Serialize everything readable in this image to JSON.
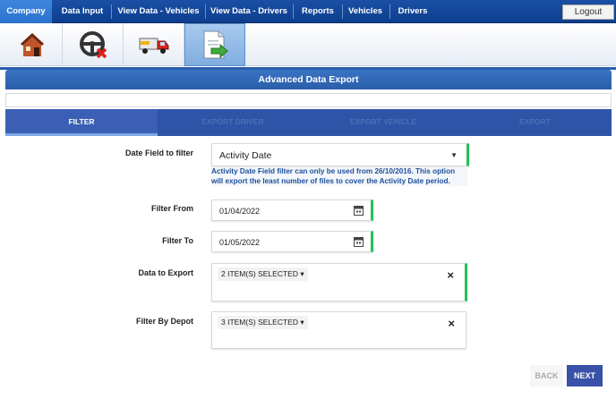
{
  "nav": {
    "items": [
      {
        "label": "Company",
        "active": true
      },
      {
        "label": "Data Input"
      },
      {
        "label": "View Data - Vehicles"
      },
      {
        "label": "View Data - Drivers"
      },
      {
        "label": "Reports"
      },
      {
        "label": "Vehicles"
      },
      {
        "label": "Drivers"
      }
    ],
    "logout": "Logout"
  },
  "toolbar": {
    "icons": [
      "house-icon",
      "steering-wheel-icon",
      "truck-icon",
      "export-document-icon"
    ],
    "active": "export-document-icon"
  },
  "page": {
    "title": "Advanced Data Export"
  },
  "steps": [
    {
      "label": "FILTER",
      "active": true
    },
    {
      "label": "EXPORT DRIVER"
    },
    {
      "label": "EXPORT VEHICLE"
    },
    {
      "label": "EXPORT"
    }
  ],
  "form": {
    "date_field": {
      "label": "Date Field to filter",
      "value": "Activity Date"
    },
    "note": "Activity Date Field filter can only be used from 26/10/2016. This option will export the least number of files to cover the Activity Date period.",
    "filter_from": {
      "label": "Filter From",
      "value": "01/04/2022"
    },
    "filter_to": {
      "label": "Filter To",
      "value": "01/05/2022"
    },
    "data_to_export": {
      "label": "Data to Export",
      "value": "2 ITEM(S) SELECTED"
    },
    "filter_by_depot": {
      "label": "Filter By Depot",
      "value": "3 ITEM(S) SELECTED"
    }
  },
  "buttons": {
    "back": "BACK",
    "next": "NEXT"
  },
  "colors": {
    "nav": "#0e3f8e",
    "accent": "#2a5ea9",
    "valid": "#23c25b",
    "next": "#3a51a8"
  }
}
